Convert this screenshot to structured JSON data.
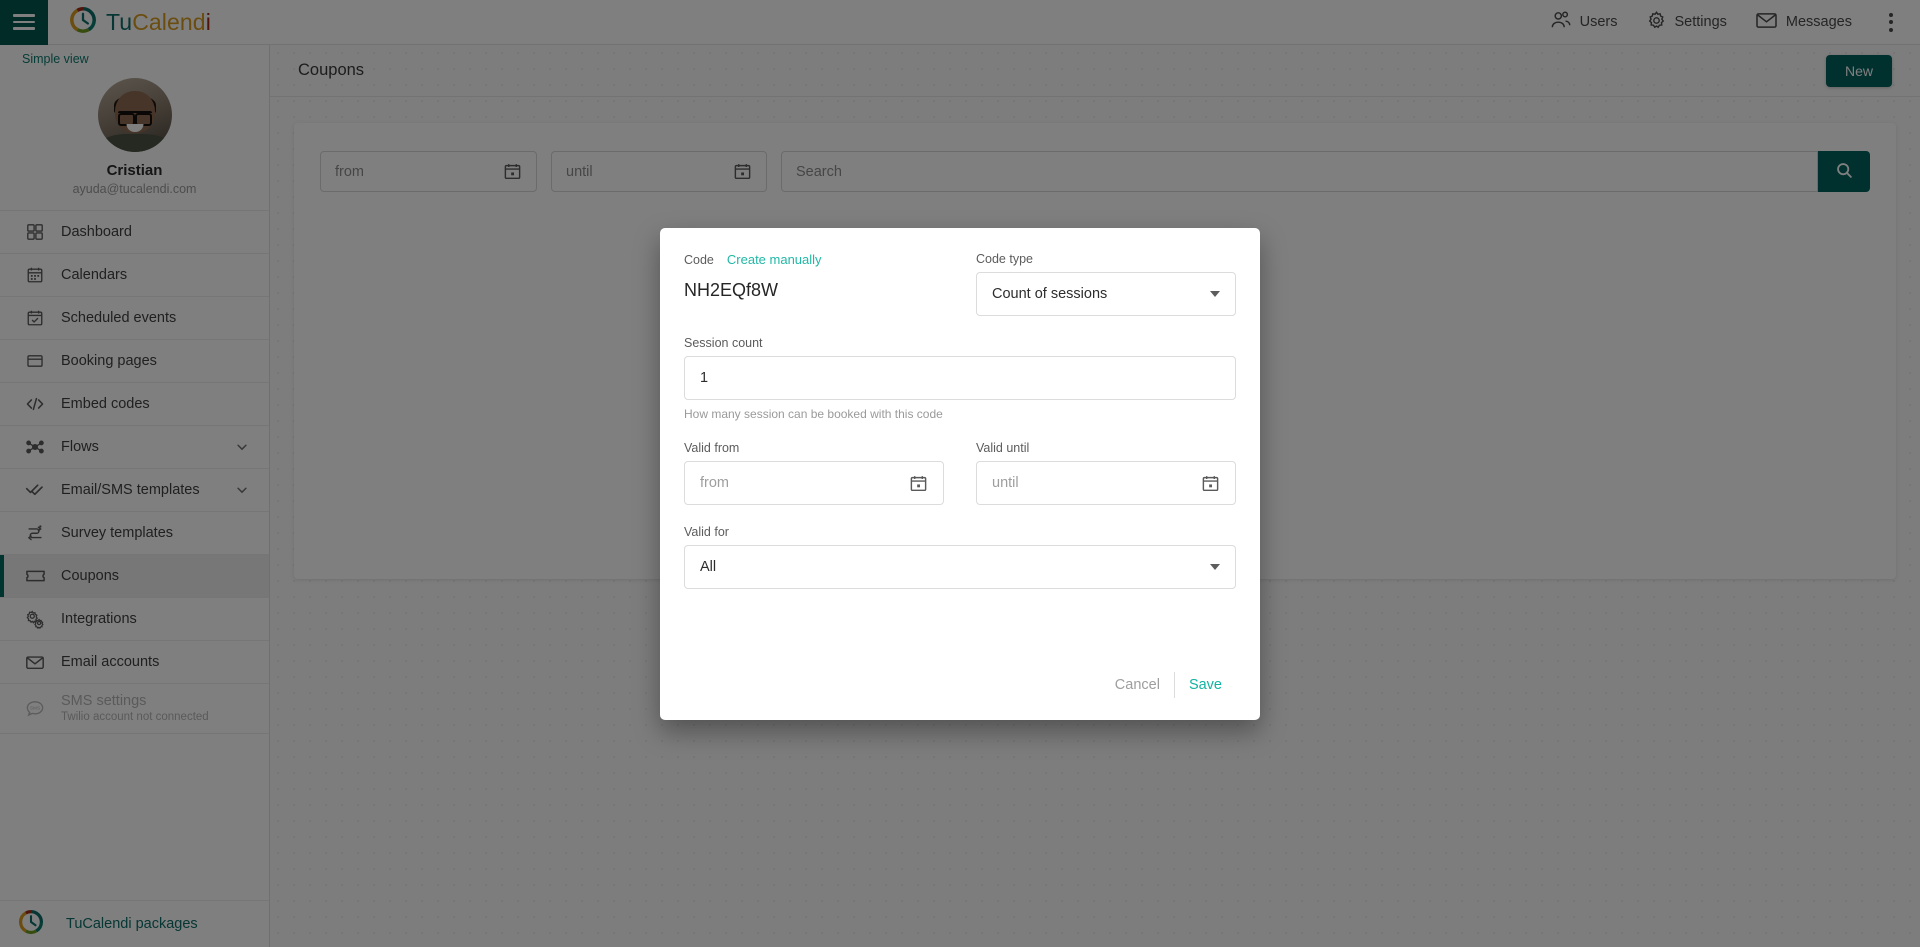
{
  "topbar": {
    "brand": {
      "part1": "Tu",
      "part2": "Calend",
      "part3": "i"
    },
    "menu_icon": "hamburger-icon",
    "items": [
      {
        "label": "Users",
        "icon": "users-icon"
      },
      {
        "label": "Settings",
        "icon": "gear-icon"
      },
      {
        "label": "Messages",
        "icon": "envelope-icon"
      }
    ],
    "overflow_icon": "kebab-menu-icon"
  },
  "sidebar": {
    "simple_view": "Simple view",
    "profile": {
      "name": "Cristian",
      "email": "ayuda@tucalendi.com"
    },
    "items": [
      {
        "label": "Dashboard",
        "icon": "dashboard-grid-icon",
        "expandable": false,
        "active": false,
        "disabled": false
      },
      {
        "label": "Calendars",
        "icon": "calendar-icon",
        "expandable": false,
        "active": false,
        "disabled": false
      },
      {
        "label": "Scheduled events",
        "icon": "calendar-check-icon",
        "expandable": false,
        "active": false,
        "disabled": false
      },
      {
        "label": "Booking pages",
        "icon": "window-icon",
        "expandable": false,
        "active": false,
        "disabled": false
      },
      {
        "label": "Embed codes",
        "icon": "code-brackets-icon",
        "expandable": false,
        "active": false,
        "disabled": false
      },
      {
        "label": "Flows",
        "icon": "flow-nodes-icon",
        "expandable": true,
        "active": false,
        "disabled": false
      },
      {
        "label": "Email/SMS templates",
        "icon": "double-check-icon",
        "expandable": true,
        "active": false,
        "disabled": false
      },
      {
        "label": "Survey templates",
        "icon": "survey-arrows-icon",
        "expandable": false,
        "active": false,
        "disabled": false
      },
      {
        "label": "Coupons",
        "icon": "ticket-icon",
        "expandable": false,
        "active": true,
        "disabled": false
      },
      {
        "label": "Integrations",
        "icon": "gears-icon",
        "expandable": false,
        "active": false,
        "disabled": false
      },
      {
        "label": "Email accounts",
        "icon": "envelope-icon",
        "expandable": false,
        "active": false,
        "disabled": false
      },
      {
        "label": "SMS settings",
        "sublabel": "Twilio account not connected",
        "icon": "sms-bubble-icon",
        "expandable": false,
        "active": false,
        "disabled": true
      }
    ],
    "footer": {
      "label": "TuCalendi packages",
      "icon": "tucalendi-logo-icon"
    }
  },
  "page": {
    "title": "Coupons",
    "new_button": "New",
    "filters": {
      "from_placeholder": "from",
      "until_placeholder": "until",
      "search_placeholder": "Search",
      "from_value": "",
      "until_value": "",
      "search_value": "",
      "search_button_icon": "search-icon",
      "calendar_icon": "calendar-icon"
    }
  },
  "modal": {
    "code_label": "Code",
    "create_manually_link": "Create manually",
    "code_value": "NH2EQf8W",
    "code_type_label": "Code type",
    "code_type_value": "Count of sessions",
    "session_count_label": "Session count",
    "session_count_value": "1",
    "session_count_hint": "How many session can be booked with this code",
    "valid_from_label": "Valid from",
    "valid_from_placeholder": "from",
    "valid_from_value": "",
    "valid_until_label": "Valid until",
    "valid_until_placeholder": "until",
    "valid_until_value": "",
    "valid_for_label": "Valid for",
    "valid_for_value": "All",
    "cancel_label": "Cancel",
    "save_label": "Save"
  },
  "colors": {
    "brand_teal": "#0d6e68",
    "brand_gold": "#d79a21",
    "brand_red": "#a52b16",
    "primary_button": "#00635c",
    "link_teal": "#22b8a6",
    "save_teal": "#11b3a0",
    "header_dark": "#02564f",
    "active_bar": "#00695f"
  }
}
